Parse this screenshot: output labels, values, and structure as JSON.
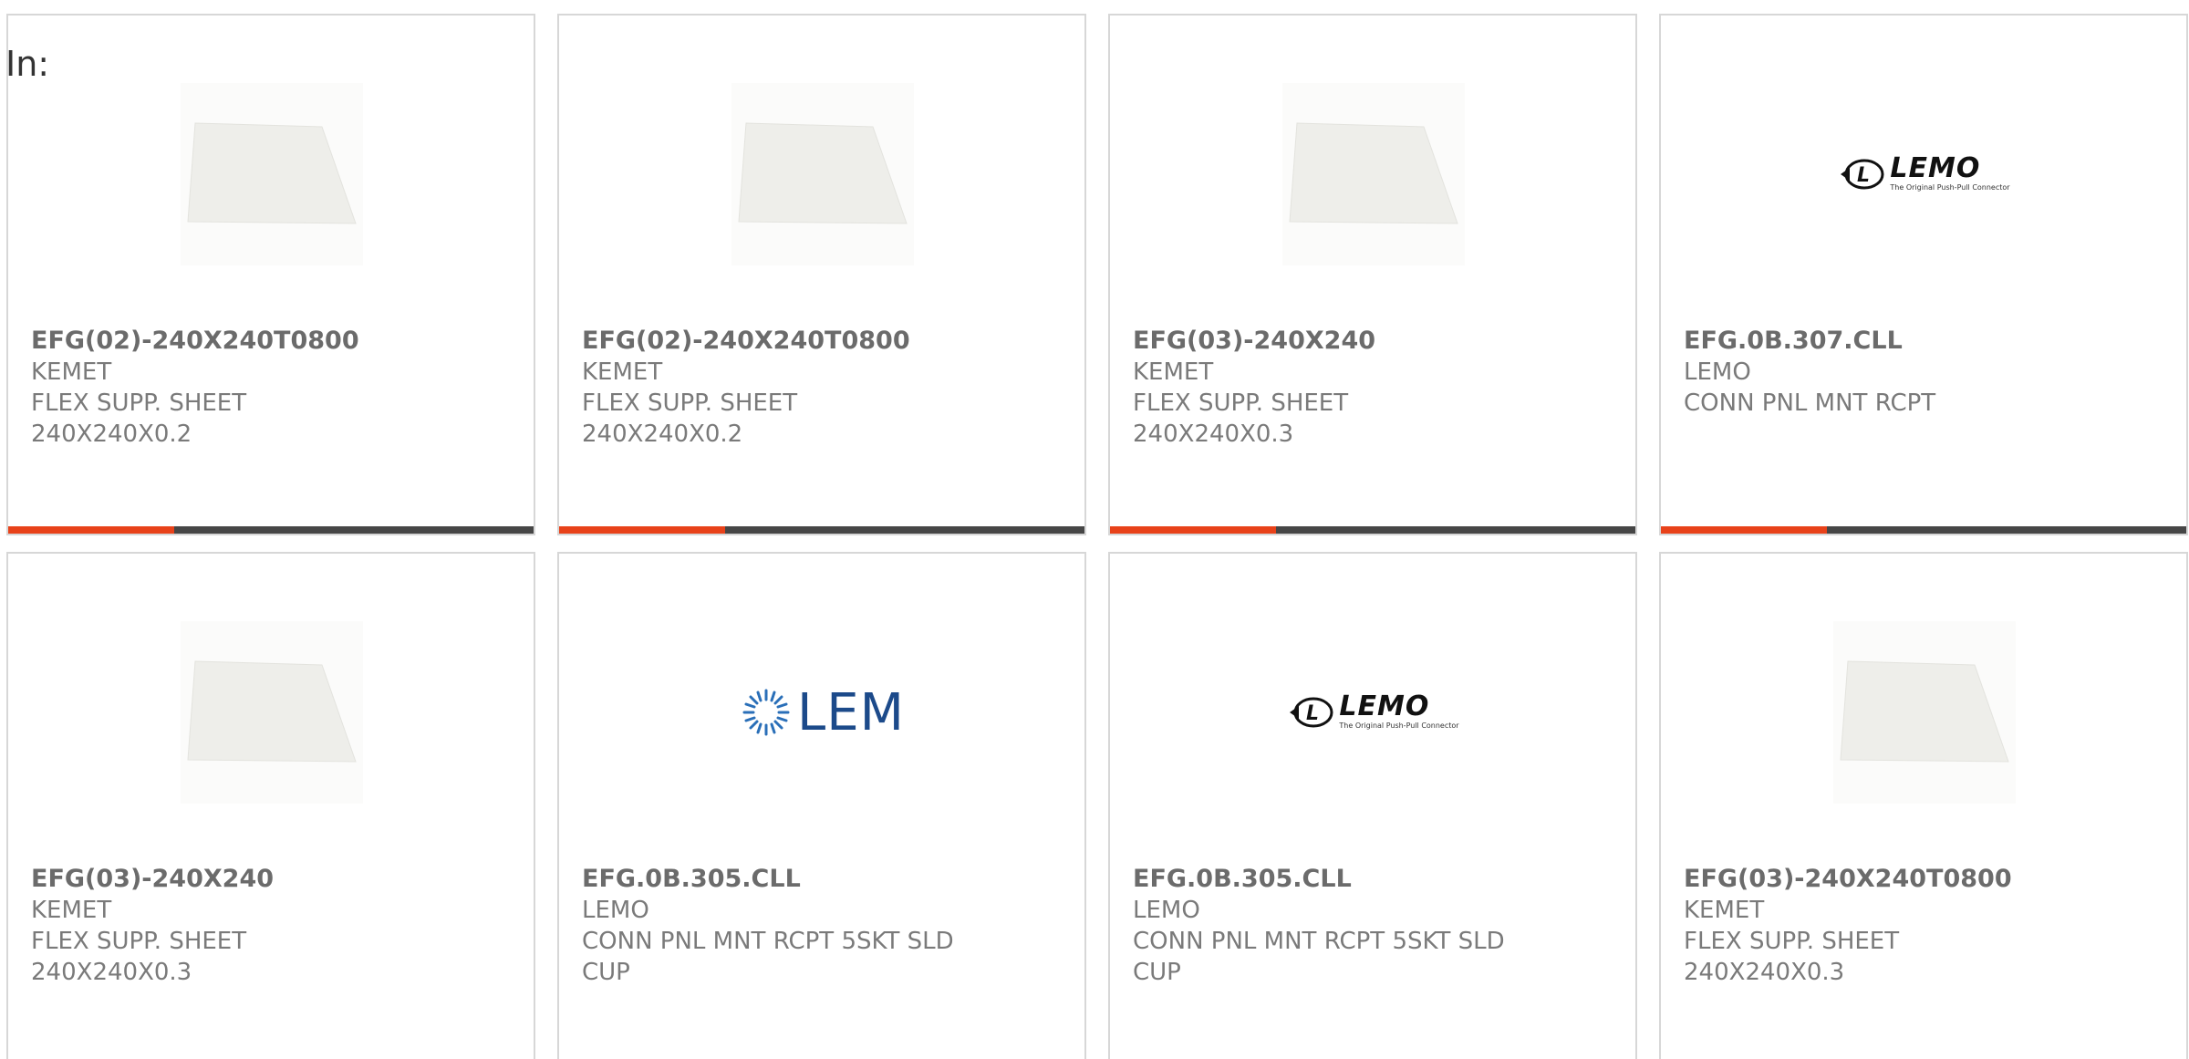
{
  "filter": {
    "label": "In:"
  },
  "colors": {
    "accent": "#e8421a",
    "bar": "#464646",
    "border": "#d7d7d7"
  },
  "products": [
    {
      "part_number": "EFG(02)-240X240T0800",
      "manufacturer": "KEMET",
      "description": "FLEX SUPP. SHEET 240X240X0.2",
      "image": "sheet"
    },
    {
      "part_number": "EFG(02)-240X240T0800",
      "manufacturer": "KEMET",
      "description": "FLEX SUPP. SHEET 240X240X0.2",
      "image": "sheet"
    },
    {
      "part_number": "EFG(03)-240X240",
      "manufacturer": "KEMET",
      "description": "FLEX SUPP. SHEET 240X240X0.3",
      "image": "sheet"
    },
    {
      "part_number": "EFG.0B.307.CLL",
      "manufacturer": "LEMO",
      "description": "CONN PNL MNT RCPT",
      "image": "lemo-logo",
      "logo_text": "LEMO",
      "logo_tagline": "The Original Push-Pull Connector"
    },
    {
      "part_number": "EFG(03)-240X240",
      "manufacturer": "KEMET",
      "description": "FLEX SUPP. SHEET 240X240X0.3",
      "image": "sheet"
    },
    {
      "part_number": "EFG.0B.305.CLL",
      "manufacturer": "LEMO",
      "description": "CONN PNL MNT RCPT 5SKT SLD CUP",
      "image": "lem-logo",
      "logo_text": "LEM"
    },
    {
      "part_number": "EFG.0B.305.CLL",
      "manufacturer": "LEMO",
      "description": "CONN PNL MNT RCPT 5SKT SLD CUP",
      "image": "lemo-logo",
      "logo_text": "LEMO",
      "logo_tagline": "The Original Push-Pull Connector"
    },
    {
      "part_number": "EFG(03)-240X240T0800",
      "manufacturer": "KEMET",
      "description": "FLEX SUPP. SHEET 240X240X0.3",
      "image": "sheet"
    }
  ]
}
